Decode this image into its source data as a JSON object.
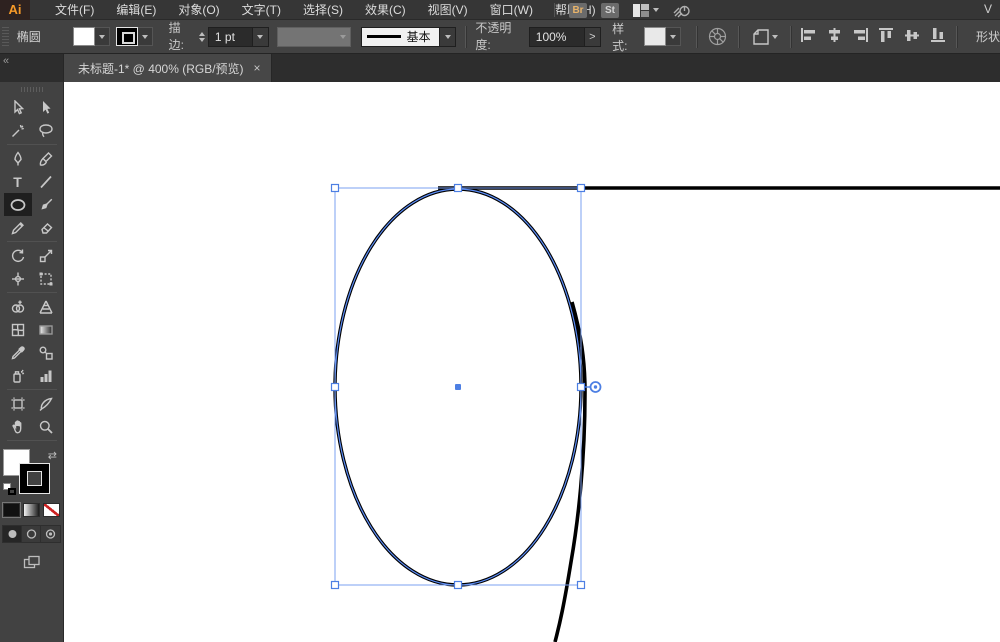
{
  "app": {
    "logo": "Ai"
  },
  "menubar": {
    "items": [
      "文件(F)",
      "编辑(E)",
      "对象(O)",
      "文字(T)",
      "选择(S)",
      "效果(C)",
      "视图(V)",
      "窗口(W)",
      "帮助(H)"
    ],
    "bridge_button": "Br",
    "stock_button": "St",
    "partial_right_text": "V"
  },
  "controlbar": {
    "context_label": "椭圆",
    "stroke_label": "描边:",
    "stroke_weight": "1 pt",
    "brush_name": "基本",
    "opacity_label": "不透明度:",
    "opacity_value": "100%",
    "more_button": ">",
    "style_label": "样式:",
    "shape_label": "形状",
    "icons": [
      "recolor-artwork",
      "transform-options",
      "align-left",
      "align-h-center",
      "align-right",
      "align-top",
      "align-v-center",
      "align-bottom"
    ]
  },
  "tab": {
    "collapse": "«",
    "title": "未标题-1* @ 400% (RGB/预览)",
    "close": "×"
  },
  "toolbar": {
    "selected_tool": "ellipse",
    "type_tool_glyph": "T",
    "tools": [
      "selection",
      "direct-selection",
      "magic-wand",
      "lasso",
      "pen",
      "curvature",
      "type",
      "line-segment",
      "ellipse",
      "paintbrush",
      "pencil",
      "eraser",
      "rotate",
      "scale",
      "width",
      "free-transform",
      "shape-builder",
      "perspective-grid",
      "mesh",
      "gradient",
      "eyedropper",
      "blend",
      "symbol-sprayer",
      "column-graph",
      "artboard",
      "slice",
      "hand",
      "zoom"
    ],
    "swap_glyph": "⇄"
  },
  "document": {
    "name": "未标题-1",
    "zoom_level": "400%",
    "color_mode": "RGB",
    "view_mode": "预览",
    "selected_object": "椭圆 (ellipse)",
    "fill_color": "#ffffff",
    "stroke_color": "#000000",
    "selection_color": "#5b8cf5"
  }
}
